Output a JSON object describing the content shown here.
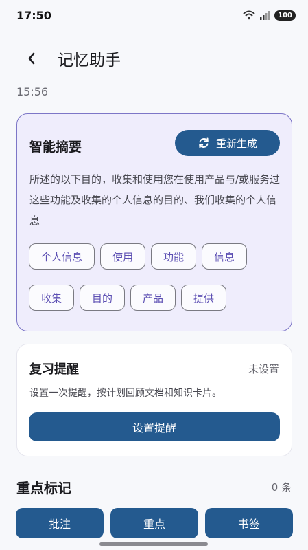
{
  "status_bar": {
    "time": "17:50",
    "battery": "100"
  },
  "header": {
    "title": "记忆助手"
  },
  "timestamp": "15:56",
  "summary": {
    "title": "智能摘要",
    "regenerate_label": "重新生成",
    "text": "所述的以下目的，收集和使用您在使用产品与/或服务过这些功能及收集的个人信息的目的、我们收集的个人信息",
    "tags": [
      "个人信息",
      "使用",
      "功能",
      "信息",
      "收集",
      "目的",
      "产品",
      "提供"
    ]
  },
  "review": {
    "title": "复习提醒",
    "status": "未设置",
    "description": "设置一次提醒，按计划回顾文档和知识卡片。",
    "button_label": "设置提醒"
  },
  "highlights": {
    "title": "重点标记",
    "count": "0 条",
    "buttons": [
      "批注",
      "重点",
      "书签"
    ]
  },
  "colors": {
    "accent": "#245a8f",
    "summary_bg": "#efedfc",
    "summary_border": "#7d76c7",
    "tag_text": "#5c4fb3"
  }
}
